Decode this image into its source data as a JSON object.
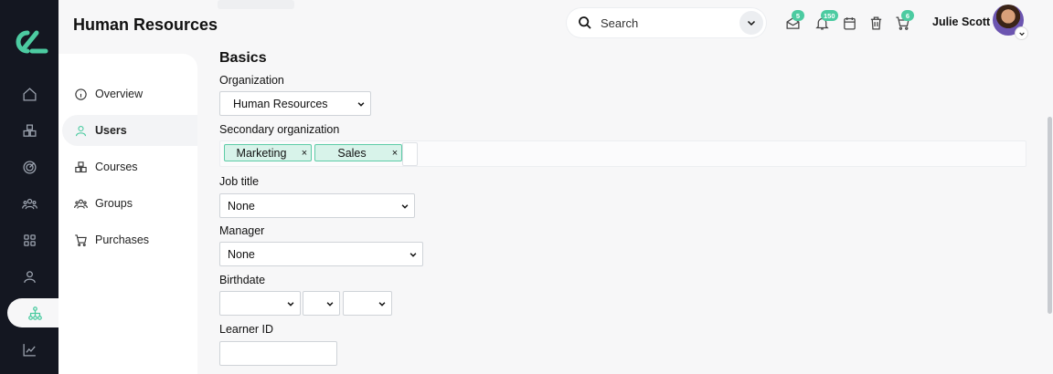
{
  "header": {
    "title": "Human Resources",
    "search_placeholder": "Search",
    "messages_count": "5",
    "notifications_count": "150",
    "cart_count": "6",
    "user_name": "Julie Scott"
  },
  "sidenav": {
    "items": [
      {
        "label": "Overview",
        "icon": "info-icon"
      },
      {
        "label": "Users",
        "icon": "user-icon",
        "active": true
      },
      {
        "label": "Courses",
        "icon": "boxes-icon"
      },
      {
        "label": "Groups",
        "icon": "group-icon"
      },
      {
        "label": "Purchases",
        "icon": "cart-icon"
      }
    ]
  },
  "form": {
    "section_title": "Basics",
    "organization": {
      "label": "Organization",
      "value": "Human Resources"
    },
    "secondary_organization": {
      "label": "Secondary organization",
      "tags": [
        "Marketing",
        "Sales"
      ],
      "remove_glyph": "×"
    },
    "job_title": {
      "label": "Job title",
      "value": "None"
    },
    "manager": {
      "label": "Manager",
      "value": "None"
    },
    "birthdate": {
      "label": "Birthdate"
    },
    "learner_id": {
      "label": "Learner ID",
      "value": ""
    }
  },
  "colors": {
    "rail": "#141721",
    "accent": "#4ccba1",
    "tag_bg": "#d8f3ea"
  }
}
